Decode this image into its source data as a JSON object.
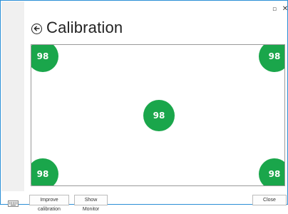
{
  "window": {
    "restore_glyph": "▫",
    "close_glyph": "✕"
  },
  "header": {
    "title": "Calibration",
    "back_icon": "back-arrow-circle-icon"
  },
  "calibration": {
    "point_color": "#1aa64b",
    "points": [
      {
        "id": "top-left",
        "value": "98"
      },
      {
        "id": "top-right",
        "value": "98"
      },
      {
        "id": "center",
        "value": "98"
      },
      {
        "id": "bottom-left",
        "value": "98"
      },
      {
        "id": "bottom-right",
        "value": "98"
      }
    ]
  },
  "footer": {
    "keyboard_icon": "keyboard-icon",
    "improve_label": "Improve calibration",
    "monitor_label": "Show Monitor",
    "close_label": "Close"
  }
}
